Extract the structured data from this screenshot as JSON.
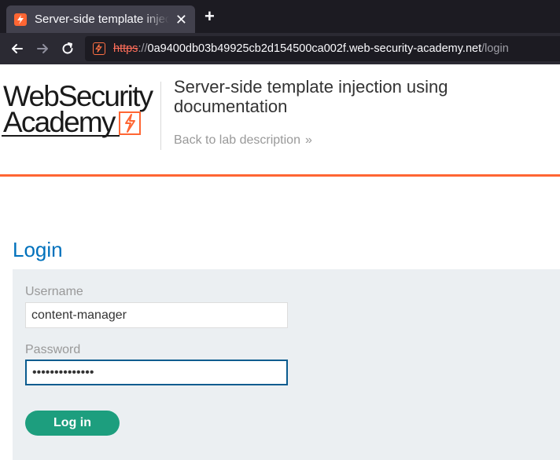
{
  "browser": {
    "tab_title": "Server-side template injection using documentation",
    "tab_close": "✕",
    "new_tab": "+",
    "url": {
      "scheme": "https",
      "separator": "://",
      "host": "0a9400db03b49925cb2d154500ca002f.web-security-academy.net",
      "path": "/login"
    }
  },
  "header": {
    "logo_line1": "WebSecurity",
    "logo_line2": "Academy",
    "lab_title": "Server-side template injection using documentation",
    "back_link": "Back to lab description",
    "back_chevron": "»"
  },
  "login": {
    "heading": "Login",
    "username_label": "Username",
    "username_value": "content-manager",
    "password_label": "Password",
    "password_value": "••••••••••••••",
    "submit_label": "Log in"
  },
  "colors": {
    "brand_orange": "#ff6633",
    "link_blue": "#0071bc",
    "button_green": "#1d9e7e",
    "panel_bg": "#ebeff2"
  },
  "icons": {
    "tab_favicon": "lightning-bolt-icon",
    "back": "arrow-left-icon",
    "forward": "arrow-right-icon",
    "reload": "reload-icon",
    "site_identity": "lightning-bolt-icon"
  }
}
